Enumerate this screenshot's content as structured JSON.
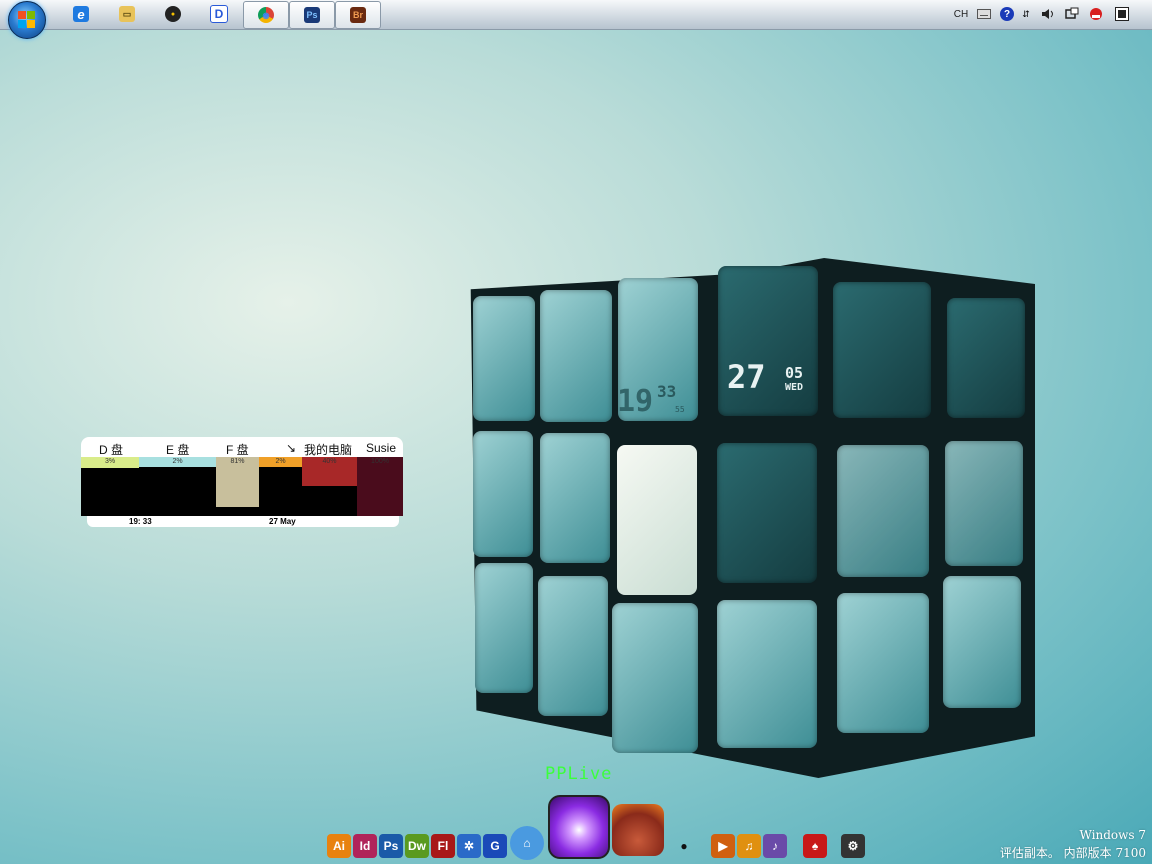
{
  "taskbar": {
    "pinned": [
      {
        "name": "ie-icon",
        "label": "e"
      },
      {
        "name": "explorer-icon",
        "label": "▭"
      },
      {
        "name": "qq-icon",
        "label": "●"
      },
      {
        "name": "d-app-icon",
        "label": "D"
      }
    ],
    "running": [
      {
        "name": "chrome-icon",
        "label": "◉"
      },
      {
        "name": "photoshop-icon",
        "label": "Ps"
      },
      {
        "name": "bridge-icon",
        "label": "Br"
      }
    ],
    "tray": {
      "language": "CH"
    }
  },
  "cube_clock": {
    "time_hh": "19",
    "time_mm": "33",
    "seconds": "55",
    "day": "27",
    "month": "05",
    "weekday": "WED"
  },
  "drive_widget": {
    "columns": [
      {
        "label": "D 盘",
        "percent": "3%",
        "fill_fraction": 0.03,
        "color": "#d9ec8a"
      },
      {
        "label": "E 盘",
        "percent": "2%",
        "fill_fraction": 0.02,
        "color": "#a8e0e0"
      },
      {
        "label": "F 盘",
        "percent": "81%",
        "fill_fraction": 0.81,
        "color": "#c8bf9c"
      },
      {
        "label": "↘",
        "percent": "2%",
        "fill_fraction": 0.02,
        "color": "#f0a028"
      },
      {
        "label": "我的电脑",
        "percent": "40%",
        "fill_fraction": 0.4,
        "color": "#a82828"
      },
      {
        "label": "Susie",
        "percent": "100%",
        "fill_fraction": 1.0,
        "color": "#4a0c1c"
      }
    ],
    "time": "19: 33",
    "date": "27 May"
  },
  "dock": {
    "highlighted_label": "PPLive",
    "items": [
      {
        "name": "illustrator-icon",
        "label": "Ai",
        "color": "#e8820f"
      },
      {
        "name": "indesign-icon",
        "label": "Id",
        "color": "#b0245a"
      },
      {
        "name": "photoshop-dock-icon",
        "label": "Ps",
        "color": "#1a5aa8"
      },
      {
        "name": "dreamweaver-icon",
        "label": "Dw",
        "color": "#5a9a20"
      },
      {
        "name": "flash-icon",
        "label": "Fl",
        "color": "#a81818"
      },
      {
        "name": "settings-icon",
        "label": "✲",
        "color": "#2a6ac8"
      },
      {
        "name": "google-icon",
        "label": "G",
        "color": "#1a4ab8"
      },
      {
        "name": "home-icon",
        "label": "⌂",
        "color": "#4a9ae0"
      },
      {
        "name": "qq-dock-icon",
        "label": "●",
        "color": "#222222"
      },
      {
        "name": "media-player-icon",
        "label": "▶",
        "color": "#d06010"
      },
      {
        "name": "music-icon",
        "label": "♫",
        "color": "#e09010"
      },
      {
        "name": "itunes-icon",
        "label": "♪",
        "color": "#6a4aa8"
      },
      {
        "name": "spade-app-icon",
        "label": "♠",
        "color": "#c81818"
      },
      {
        "name": "gear-icon",
        "label": "⚙",
        "color": "#333333"
      }
    ]
  },
  "watermark": {
    "line1": "Windows 7",
    "line2": "评估副本。 内部版本 7100"
  }
}
